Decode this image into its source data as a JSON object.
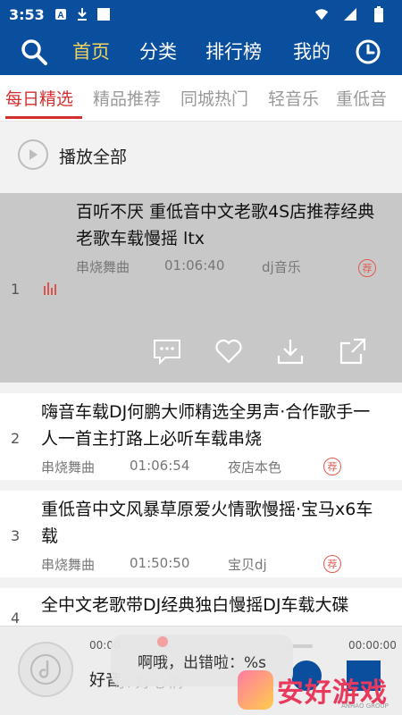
{
  "status_bar": {
    "time": "3:53",
    "icons": [
      "a-icon",
      "download-icon",
      "square-icon",
      "wifi-icon",
      "signal-icon",
      "battery-icon"
    ]
  },
  "nav": {
    "tabs": [
      "首页",
      "分类",
      "排行榜",
      "我的"
    ],
    "active_tab": "首页",
    "active_color": "#f3d35b",
    "bar_color": "#0a4f9e"
  },
  "subtabs": {
    "items": [
      "每日精选",
      "精品推荐",
      "同城热门",
      "轻音乐",
      "重低音"
    ],
    "active": "每日精选",
    "accent_color": "#d32f2f"
  },
  "play_all": {
    "label": "播放全部"
  },
  "songs": [
    {
      "index": "1",
      "title": "百听不厌 重低音中文老歌4S店推荐经典老歌车载慢摇 ltx",
      "genre": "串烧舞曲",
      "duration": "01:06:40",
      "artist": "dj音乐",
      "badge": "荐",
      "playing": true
    },
    {
      "index": "2",
      "title": "嗨音车载DJ何鹏大师精选全男声·合作歌手一人一首主打路上必听车载串烧",
      "genre": "串烧舞曲",
      "duration": "01:06:54",
      "artist": "夜店本色",
      "badge": "荐"
    },
    {
      "index": "3",
      "title": "重低音中文风暴草原爱火情歌慢摇·宝马x6车载",
      "genre": "串烧舞曲",
      "duration": "01:50:50",
      "artist": "宝贝dj",
      "badge": "荐"
    },
    {
      "index": "4",
      "title": "全中文老歌带DJ经典独白慢摇DJ车载大碟"
    }
  ],
  "player": {
    "time_start": "00:00",
    "time_end": "00:00:00",
    "song_title": "好音",
    "song_subtitle": "乐 好心情"
  },
  "toast": {
    "text": "啊哦，出错啦：%s"
  },
  "watermark": {
    "text": "安好游戏",
    "sub": "ANHAO GROUP"
  }
}
